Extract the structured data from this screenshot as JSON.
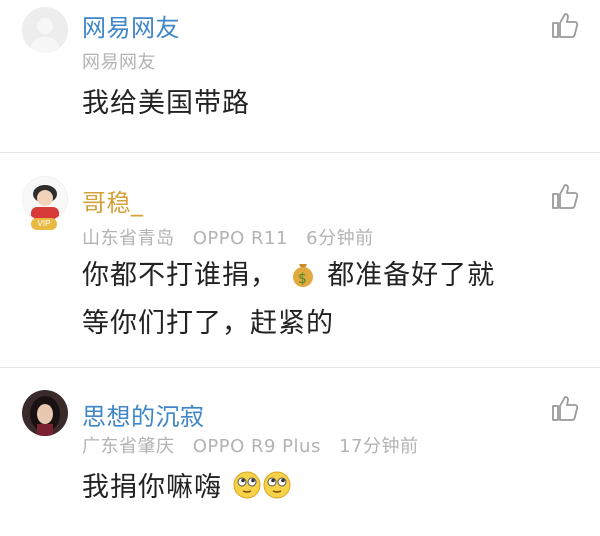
{
  "comments": [
    {
      "username": "网易网友",
      "meta_location": "网易网友",
      "meta_device": "",
      "meta_time": "",
      "body_line1": "我给美国带路",
      "body_line2": ""
    },
    {
      "username": "哥稳_",
      "vip_badge": "VIP",
      "meta_location": "山东省青岛",
      "meta_device": "OPPO R11",
      "meta_time": "6分钟前",
      "body_line1_a": "你都不打谁捐，",
      "body_emoji": "money-bag-emoji",
      "body_line1_b": "都准备好了就",
      "body_line2": "等你们打了，赶紧的"
    },
    {
      "username": "思想的沉寂",
      "meta_location": "广东省肇庆",
      "meta_device": "OPPO R9 Plus",
      "meta_time": "17分钟前",
      "body_line1": "我捐你嘛嗨",
      "body_emoji": "eye-roll-face-emoji"
    }
  ],
  "colors": {
    "username": "#3f86c8",
    "vip_username": "#d4a13a",
    "meta": "#b3b3b3",
    "body": "#222222",
    "divider": "#e6e6e6",
    "like_icon": "#9a9a9a"
  },
  "icons": [
    "thumbs-up-icon",
    "money-bag-emoji",
    "eye-roll-face-emoji"
  ]
}
